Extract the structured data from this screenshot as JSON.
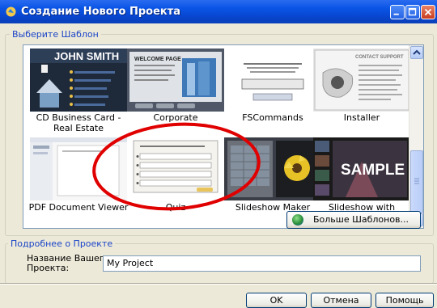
{
  "window": {
    "title": "Создание Нового Проекта"
  },
  "template_group": {
    "label": "Выберите Шаблон"
  },
  "templates": [
    {
      "label": "CD Business Card - Real Estate",
      "thumb_title": "JOHN SMITH"
    },
    {
      "label": "Corporate",
      "thumb_title": "WELCOME PAGE"
    },
    {
      "label": "FSCommands"
    },
    {
      "label": "Installer",
      "thumb_title": "CONTACT SUPPORT"
    },
    {
      "label": "PDF Document Viewer"
    },
    {
      "label": "Quiz"
    },
    {
      "label": "Slideshow Maker"
    },
    {
      "label": "Slideshow with Thumblist",
      "thumb_title": "SAMPLE"
    }
  ],
  "more_templates_button": "Больше Шаблонов...",
  "details_group": {
    "label": "Подробнее о Проекте",
    "name_label_line1": "Название Вашего",
    "name_label_line2": "Проекта:",
    "name_value": "My Project"
  },
  "buttons": {
    "ok": "OK",
    "cancel": "Отмена",
    "help": "Помощь"
  },
  "colors": {
    "titlebar": "#0a55e6",
    "dialog_bg": "#ece9d8",
    "group_label": "#1a44c8",
    "annotation": "#e00000"
  },
  "icons": {
    "app": "app-icon",
    "minimize": "minimize-icon",
    "maximize": "maximize-icon",
    "close": "close-icon",
    "more": "globe-icon",
    "scroll_up": "scroll-up-arrow-icon",
    "scroll_down": "scroll-down-arrow-icon"
  }
}
